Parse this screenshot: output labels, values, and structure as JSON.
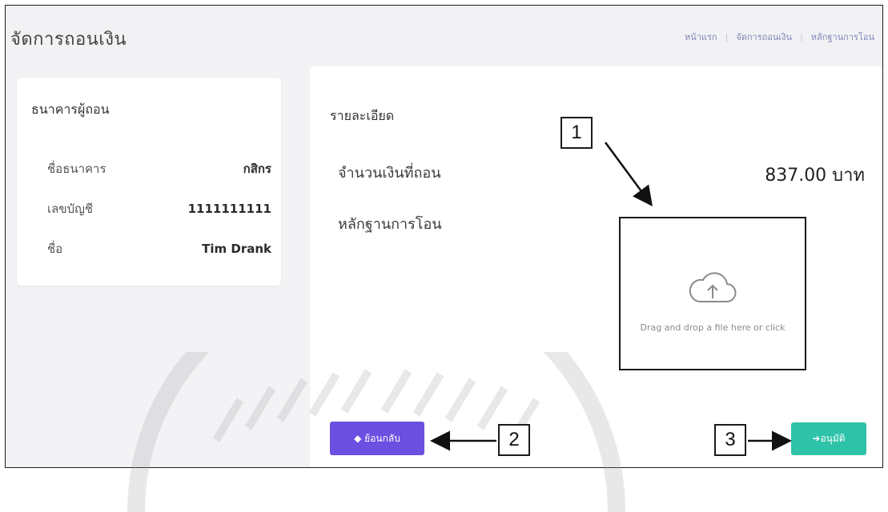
{
  "page": {
    "title": "จัดการถอนเงิน"
  },
  "breadcrumb": [
    "หน้าแรก",
    "จัดการถอนเงิน",
    "หลักฐานการโอน"
  ],
  "bank_card": {
    "heading": "ธนาคารผู้ถอน",
    "rows": [
      {
        "label": "ชื่อธนาคาร",
        "value": "กสิกร"
      },
      {
        "label": "เลขบัญชี",
        "value": "1111111111"
      },
      {
        "label": "ชื่อ",
        "value": "Tim Drank"
      }
    ]
  },
  "detail": {
    "heading": "รายละเอียด",
    "amount_label": "จำนวนเงินที่ถอน",
    "amount_value": "837.00 บาท",
    "proof_label": "หลักฐานการโอน"
  },
  "upload": {
    "hint": "Drag and drop a file here or click",
    "icon": "cloud-upload-icon"
  },
  "buttons": {
    "back_label": "ย้อนกลับ",
    "confirm_label": "อนุมัติ"
  },
  "callouts": [
    "1",
    "2",
    "3"
  ],
  "colors": {
    "back_button": "#6b4fe0",
    "confirm_button": "#2ec3a8"
  }
}
